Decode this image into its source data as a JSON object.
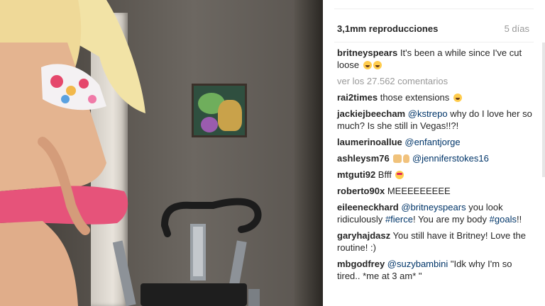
{
  "post": {
    "views": "3,1mm reproducciones",
    "age": "5 días"
  },
  "caption": {
    "user": "britneyspears",
    "text": "It's been a while since I've cut loose"
  },
  "load_more": "ver los 27.562 comentarios",
  "comments": [
    {
      "user": "rai2times",
      "pre": "those extensions",
      "mention": "",
      "post": ""
    },
    {
      "user": "jackiejbeecham",
      "pre": "",
      "mention": "@kstrepo",
      "post": "why do I love her so much? Is she still in Vegas!!?!"
    },
    {
      "user": "laumerinoallue",
      "pre": "",
      "mention": "@enfantjorge",
      "post": ""
    },
    {
      "user": "ashleysm76",
      "pre": "",
      "mention": "@jenniferstokes16",
      "post": ""
    },
    {
      "user": "mtguti92",
      "pre": "Bfff",
      "mention": "",
      "post": ""
    },
    {
      "user": "roberto90x",
      "pre": "MEEEEEEEEE",
      "mention": "",
      "post": ""
    },
    {
      "user": "eileeneckhard",
      "pre": "",
      "mention": "@britneyspears",
      "post": "you look ridiculously",
      "tag1": "#fierce",
      "post2": "! You are my body",
      "tag2": "#goals",
      "post3": "!!"
    },
    {
      "user": "garyhajdasz",
      "pre": "You still have it Britney! Love the routine! :)",
      "mention": "",
      "post": ""
    },
    {
      "user": "mbgodfrey",
      "pre": "",
      "mention": "@suzybambini",
      "post": "\"Idk why I'm so tired.. *me at 3 am* \""
    }
  ]
}
